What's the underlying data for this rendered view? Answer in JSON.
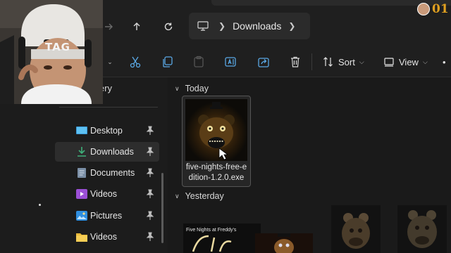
{
  "address_bar": {
    "path_segments": [
      "Downloads"
    ]
  },
  "toolbar": {
    "sort_label": "Sort",
    "view_label": "View",
    "more_label": "•"
  },
  "sidebar": {
    "header_fragment": "lery",
    "items": [
      {
        "label": "Desktop",
        "icon": "desktop-icon",
        "active": false
      },
      {
        "label": "Downloads",
        "icon": "download-icon",
        "active": true
      },
      {
        "label": "Documents",
        "icon": "documents-icon",
        "active": false
      },
      {
        "label": "Videos",
        "icon": "videos-icon",
        "active": false
      },
      {
        "label": "Pictures",
        "icon": "pictures-icon",
        "active": false
      },
      {
        "label": "Videos",
        "icon": "folder-icon",
        "active": false
      }
    ]
  },
  "content": {
    "group_today": "Today",
    "group_yesterday": "Yesterday",
    "today_file": {
      "name_line1": "five-nights-free-e",
      "name_line2": "dition-1.2.0.exe"
    },
    "yesterday_thumb_text": "Five Nights at Freddy's"
  },
  "overlay": {
    "beanie_text": "TAG",
    "badge_number": "01"
  },
  "colors": {
    "window_bg": "#1c1c1c",
    "badge": "#e0a020"
  }
}
